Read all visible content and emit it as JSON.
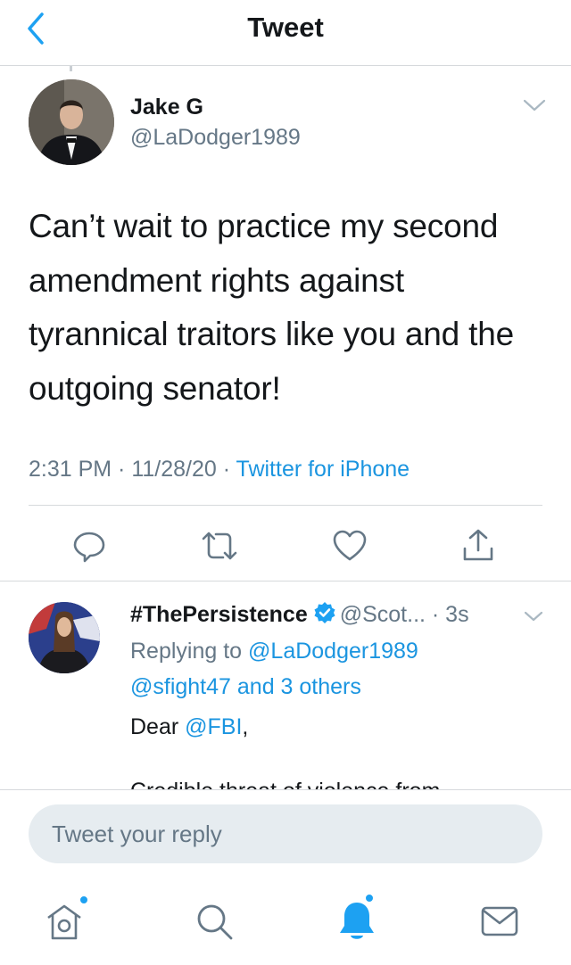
{
  "header": {
    "title": "Tweet"
  },
  "tweet": {
    "author_name": "Jake G",
    "author_handle": "@LaDodger1989",
    "text": "Can’t wait to practice my second amendment rights against tyrannical  traitors like you and the outgoing senator!",
    "time": "2:31 PM · 11/28/20 · ",
    "source": "Twitter for iPhone"
  },
  "reply": {
    "author_name": "#ThePersistence",
    "author_handle_time": "@Scot... · 3s",
    "replying_prefix": "Replying to ",
    "replying_to": "@LaDodger1989",
    "replying_others": "@sfight47 and 3 others",
    "body_prefix": "Dear ",
    "body_mention": "@FBI",
    "body_suffix": ",",
    "body_line2": "Credible threat of violence from"
  },
  "composer": {
    "placeholder": "Tweet your reply"
  },
  "icons": {
    "back": "chevron-left-icon",
    "caret": "chevron-down-icon",
    "actions": [
      "reply-icon",
      "retweet-icon",
      "like-icon",
      "share-icon"
    ],
    "tabs": [
      "home-icon",
      "search-icon",
      "notifications-icon",
      "messages-icon"
    ]
  },
  "colors": {
    "accent": "#1da1f2",
    "link": "#1b95e0",
    "muted": "#657786",
    "divider": "#d6d9dc"
  }
}
